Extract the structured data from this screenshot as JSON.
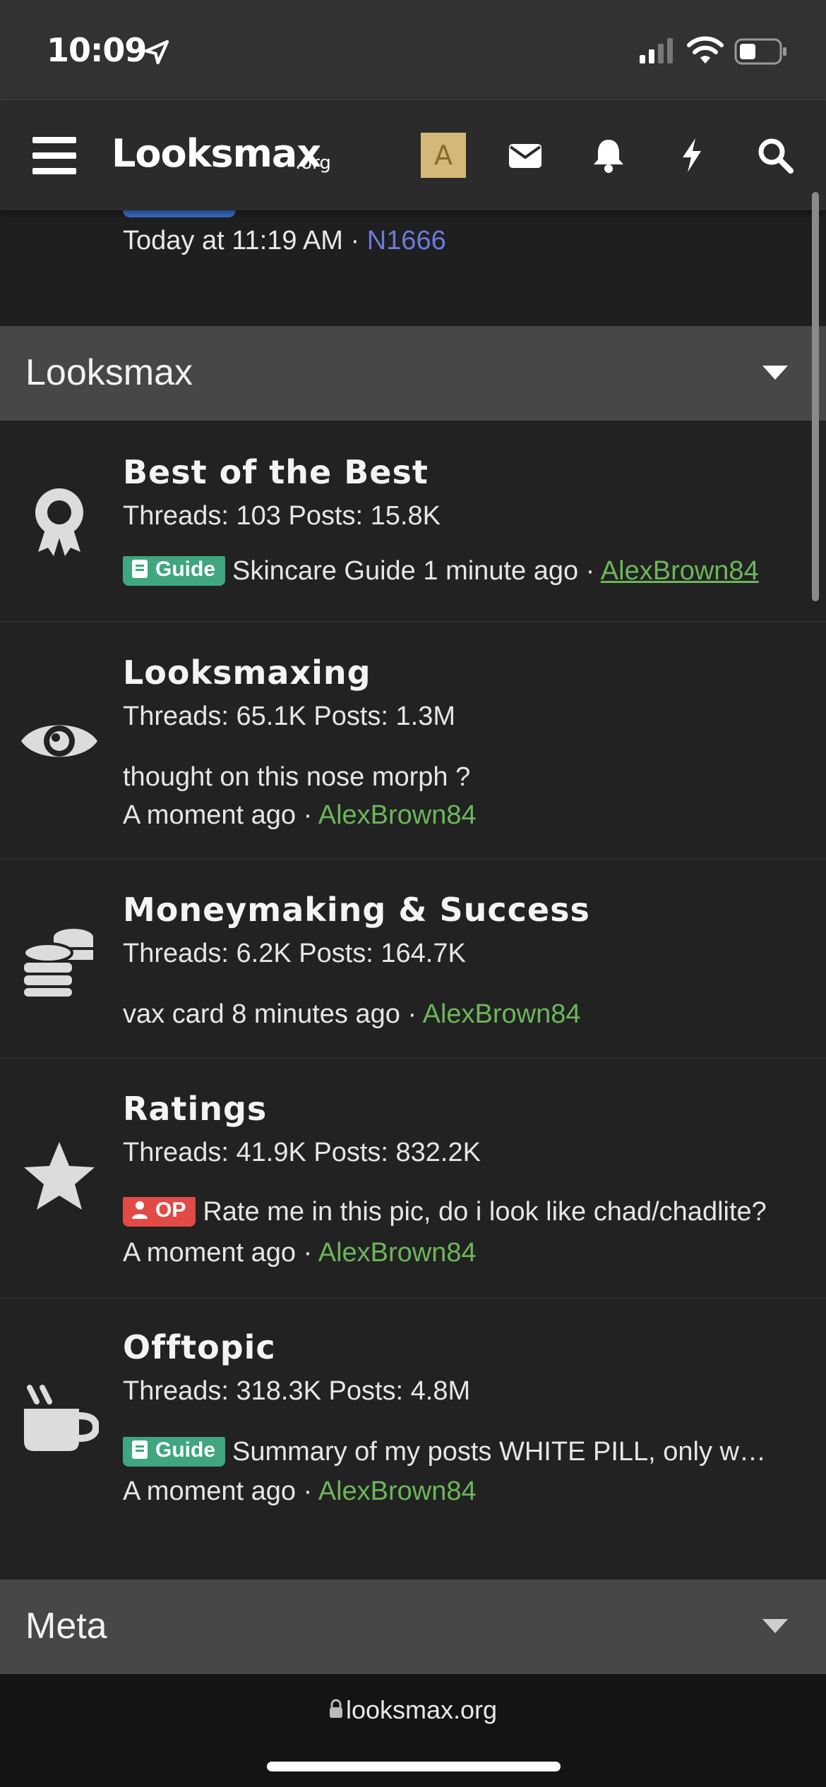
{
  "status_bar": {
    "time": "10:09"
  },
  "header": {
    "logo_main": "Looksmax",
    "logo_suffix": ".org",
    "avatar_letter": "A"
  },
  "previous_node": {
    "date": "Today at 11:19 AM",
    "separator": " · ",
    "user": "N1666"
  },
  "categories": [
    {
      "title": "Looksmax"
    },
    {
      "title": "Meta"
    }
  ],
  "nodes": [
    {
      "title": "Best of the Best",
      "stats": "Threads: 103 Posts: 15.8K",
      "prefix": "Guide",
      "latest": "Skincare Guide",
      "time": "1 minute ago",
      "separator": " · ",
      "user": "AlexBrown84"
    },
    {
      "title": "Looksmaxing",
      "stats": "Threads: 65.1K Posts: 1.3M",
      "latest": "thought on this nose morph ?",
      "time": "A moment ago",
      "separator": " · ",
      "user": "AlexBrown84"
    },
    {
      "title": "Moneymaking & Success",
      "stats": "Threads: 6.2K Posts: 164.7K",
      "latest": "vax card",
      "time": "8 minutes ago",
      "separator": " · ",
      "user": "AlexBrown84"
    },
    {
      "title": "Ratings",
      "stats": "Threads: 41.9K Posts: 832.2K",
      "prefix": "OP",
      "latest": "Rate me in this pic, do i look like chad/chadlite?",
      "time": "A moment ago",
      "separator": " · ",
      "user": "AlexBrown84"
    },
    {
      "title": "Offtopic",
      "stats": "Threads: 318.3K Posts: 4.8M",
      "prefix": "Guide",
      "latest": "Summary of my posts WHITE PILL, only w…",
      "time": "A moment ago",
      "separator": " · ",
      "user": "AlexBrown84"
    }
  ],
  "address_bar": {
    "url": "looksmax.org"
  },
  "colors": {
    "username": "#6cb65a",
    "prefix_guide": "#3fa67f",
    "prefix_op": "#e24a46",
    "avatar_bg": "#d4b877"
  },
  "icons": {
    "node_0": "award-ribbon-icon",
    "node_1": "eye-icon",
    "node_2": "coins-icon",
    "node_3": "star-icon",
    "node_4": "coffee-cup-icon"
  }
}
